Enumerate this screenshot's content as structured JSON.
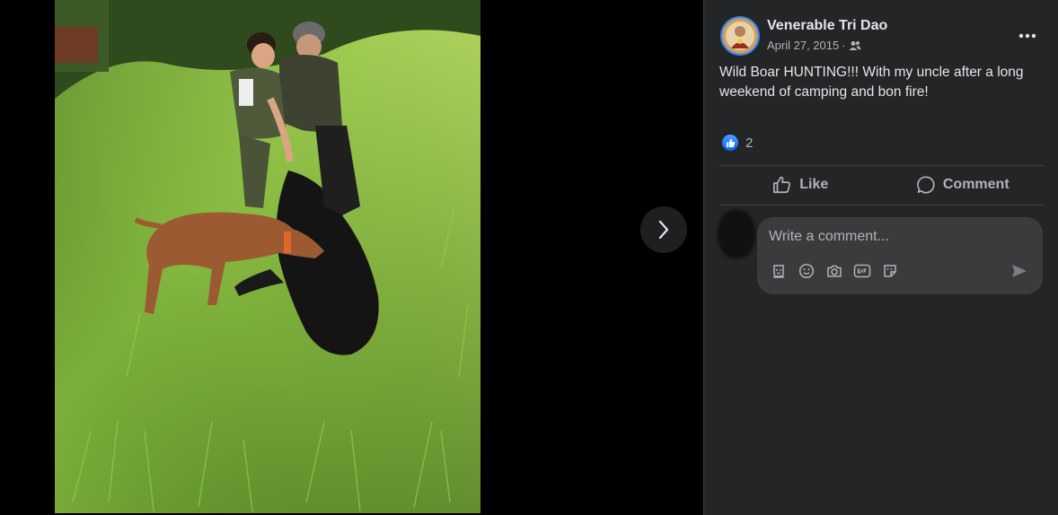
{
  "post": {
    "author": "Venerable Tri Dao",
    "date": "April 27, 2015",
    "date_separator": "·",
    "audience_icon": "friends-icon",
    "caption": "Wild Boar HUNTING!!! With my uncle after a long weekend of camping and bon fire!",
    "reaction_count": "2"
  },
  "actions": {
    "like_label": "Like",
    "comment_label": "Comment"
  },
  "composer": {
    "placeholder": "Write a comment...",
    "tools": [
      "avatar-sticker-icon",
      "emoji-icon",
      "camera-icon",
      "gif-icon",
      "sticker-icon"
    ],
    "send_icon": "send-icon"
  },
  "colors": {
    "panel_bg": "#242526",
    "accent": "#2d88ff",
    "text_primary": "#e4e6eb",
    "text_secondary": "#b0b3b8",
    "input_bg": "#3a3b3c"
  }
}
